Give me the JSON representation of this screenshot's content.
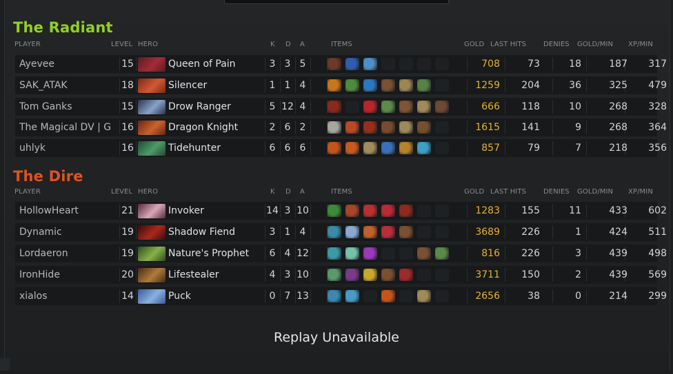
{
  "headers": {
    "player": "PLAYER",
    "level": "LEVEL",
    "hero": "HERO",
    "k": "K",
    "d": "D",
    "a": "A",
    "items": "ITEMS",
    "gold": "GOLD",
    "last_hits": "LAST HITS",
    "denies": "DENIES",
    "gold_min": "GOLD/MIN",
    "xp_min": "XP/MIN"
  },
  "teams": [
    {
      "name": "The Radiant",
      "color": "#92d120",
      "players": [
        {
          "player": "Ayevee",
          "level": "15",
          "hero": "Queen of Pain",
          "hero_colors": [
            "#5a1c24",
            "#a32a36"
          ],
          "k": "3",
          "d": "3",
          "a": "5",
          "gold": "708",
          "last_hits": "73",
          "denies": "18",
          "gpm": "187",
          "xpm": "317",
          "items": [
            [
              "claw-icon",
              "#6b3b28"
            ],
            [
              "staff-icon",
              "#2f5db0"
            ],
            [
              "crystal-icon",
              "#4f8fc4"
            ],
            [
              "",
              "#1e2123"
            ],
            [
              "",
              "#1e2123"
            ],
            [
              "",
              "#1e2123"
            ],
            [
              "",
              "#1e2123"
            ]
          ]
        },
        {
          "player": "SAK_ATAK",
          "level": "18",
          "hero": "Silencer",
          "hero_colors": [
            "#7c2818",
            "#d05a32"
          ],
          "k": "1",
          "d": "1",
          "a": "4",
          "gold": "1259",
          "last_hits": "204",
          "denies": "36",
          "gpm": "325",
          "xpm": "479",
          "items": [
            [
              "orb-icon",
              "#c8761c"
            ],
            [
              "wand-icon",
              "#4d8a3e"
            ],
            [
              "sphere-icon",
              "#2c78c0"
            ],
            [
              "boots-icon",
              "#7a5034"
            ],
            [
              "scroll-icon",
              "#9b8654"
            ],
            [
              "branch-icon",
              "#568246"
            ],
            [
              "",
              "#1e2123"
            ]
          ]
        },
        {
          "player": "Tom Ganks",
          "level": "15",
          "hero": "Drow Ranger",
          "hero_colors": [
            "#2a3450",
            "#8aa2c8"
          ],
          "k": "5",
          "d": "12",
          "a": "4",
          "gold": "666",
          "last_hits": "118",
          "denies": "10",
          "gpm": "268",
          "xpm": "328",
          "items": [
            [
              "armor-icon",
              "#8b2a1c"
            ],
            [
              "",
              "#1e2123"
            ],
            [
              "axe-icon",
              "#b8262c"
            ],
            [
              "branch-icon",
              "#5c8a4a"
            ],
            [
              "boots-icon",
              "#7e5536"
            ],
            [
              "scroll-icon",
              "#a08a5a"
            ],
            [
              "boots-icon",
              "#6d4a30"
            ]
          ]
        },
        {
          "player": "The Magical DV | G",
          "level": "16",
          "hero": "Dragon Knight",
          "hero_colors": [
            "#6a2418",
            "#c8642a"
          ],
          "k": "2",
          "d": "6",
          "a": "2",
          "gold": "1615",
          "last_hits": "141",
          "denies": "9",
          "gpm": "268",
          "xpm": "364",
          "items": [
            [
              "axe-icon",
              "#a8a6a0"
            ],
            [
              "sword-icon",
              "#b84a24"
            ],
            [
              "armor-icon",
              "#962e1c"
            ],
            [
              "shield-icon",
              "#7a4a2c"
            ],
            [
              "scroll-icon",
              "#9e8a58"
            ],
            [
              "boots-icon",
              "#76502f"
            ],
            [
              "",
              "#1e2123"
            ]
          ]
        },
        {
          "player": "uhlyk",
          "level": "16",
          "hero": "Tidehunter",
          "hero_colors": [
            "#1e4a36",
            "#4f9a68"
          ],
          "k": "6",
          "d": "6",
          "a": "6",
          "gold": "857",
          "last_hits": "79",
          "denies": "7",
          "gpm": "218",
          "xpm": "356",
          "items": [
            [
              "orb-icon",
              "#c4541c"
            ],
            [
              "orb-icon",
              "#c85a20"
            ],
            [
              "scroll-icon",
              "#a38c5c"
            ],
            [
              "staff-icon",
              "#3a70b8"
            ],
            [
              "claw-icon",
              "#b8822c"
            ],
            [
              "crystal-icon",
              "#3d9ec6"
            ],
            [
              "",
              "#1e2123"
            ]
          ]
        }
      ]
    },
    {
      "name": "The Dire",
      "color": "#e0531f",
      "players": [
        {
          "player": "HollowHeart",
          "level": "21",
          "hero": "Invoker",
          "hero_colors": [
            "#5a2a3a",
            "#d8a8b8"
          ],
          "k": "14",
          "d": "3",
          "a": "10",
          "gold": "1283",
          "last_hits": "155",
          "denies": "11",
          "gpm": "433",
          "xpm": "602",
          "items": [
            [
              "staff-icon",
              "#3c8a3a"
            ],
            [
              "claw-icon",
              "#a8442a"
            ],
            [
              "sword-icon",
              "#b83030"
            ],
            [
              "axe-icon",
              "#b82a34"
            ],
            [
              "armor-icon",
              "#8e2a1c"
            ],
            [
              "",
              "#1e2123"
            ],
            [
              "",
              "#1e2123"
            ]
          ]
        },
        {
          "player": "Dynamic",
          "level": "19",
          "hero": "Shadow Fiend",
          "hero_colors": [
            "#3a0c0c",
            "#a8281c"
          ],
          "k": "3",
          "d": "1",
          "a": "4",
          "gold": "3689",
          "last_hits": "226",
          "denies": "1",
          "gpm": "424",
          "xpm": "511",
          "items": [
            [
              "claw-icon",
              "#3a8aa8"
            ],
            [
              "crystal-icon",
              "#8aa8d0"
            ],
            [
              "sword-icon",
              "#c0602a"
            ],
            [
              "axe-icon",
              "#b82e3a"
            ],
            [
              "boots-icon",
              "#7a5030"
            ],
            [
              "",
              "#1e2123"
            ],
            [
              "",
              "#1e2123"
            ]
          ]
        },
        {
          "player": "Lordaeron",
          "level": "19",
          "hero": "Nature's Prophet",
          "hero_colors": [
            "#2e4a22",
            "#8ab048"
          ],
          "k": "6",
          "d": "4",
          "a": "12",
          "gold": "816",
          "last_hits": "226",
          "denies": "3",
          "gpm": "439",
          "xpm": "498",
          "items": [
            [
              "wand-icon",
              "#3a9aa8"
            ],
            [
              "crystal-icon",
              "#78c0a8"
            ],
            [
              "orb-icon",
              "#9a3ab8"
            ],
            [
              "",
              "#1e2123"
            ],
            [
              "",
              "#1e2123"
            ],
            [
              "boots-icon",
              "#7a5034"
            ],
            [
              "branch-icon",
              "#5a8a48"
            ]
          ]
        },
        {
          "player": "IronHide",
          "level": "20",
          "hero": "Lifestealer",
          "hero_colors": [
            "#4a2a14",
            "#b07a3a"
          ],
          "k": "4",
          "d": "3",
          "a": "10",
          "gold": "3711",
          "last_hits": "150",
          "denies": "2",
          "gpm": "439",
          "xpm": "569",
          "items": [
            [
              "branch-icon",
              "#5a9a6a"
            ],
            [
              "claw-icon",
              "#7a3a8a"
            ],
            [
              "shield-icon",
              "#c8a82a"
            ],
            [
              "boots-icon",
              "#7a5030"
            ],
            [
              "armor-icon",
              "#a02a2a"
            ],
            [
              "",
              "#1e2123"
            ],
            [
              "",
              "#1e2123"
            ]
          ]
        },
        {
          "player": "xialos",
          "level": "14",
          "hero": "Puck",
          "hero_colors": [
            "#3a5a9a",
            "#8ab0e0"
          ],
          "k": "0",
          "d": "7",
          "a": "13",
          "gold": "2656",
          "last_hits": "38",
          "denies": "0",
          "gpm": "214",
          "xpm": "299",
          "items": [
            [
              "claw-icon",
              "#3a8ab0"
            ],
            [
              "crystal-icon",
              "#4a9ac8"
            ],
            [
              "",
              "#1e2123"
            ],
            [
              "orb-icon",
              "#c8541c"
            ],
            [
              "",
              "#1e2123"
            ],
            [
              "scroll-icon",
              "#a08a58"
            ],
            [
              "",
              "#1e2123"
            ]
          ]
        }
      ]
    }
  ],
  "footer": "Replay Unavailable"
}
